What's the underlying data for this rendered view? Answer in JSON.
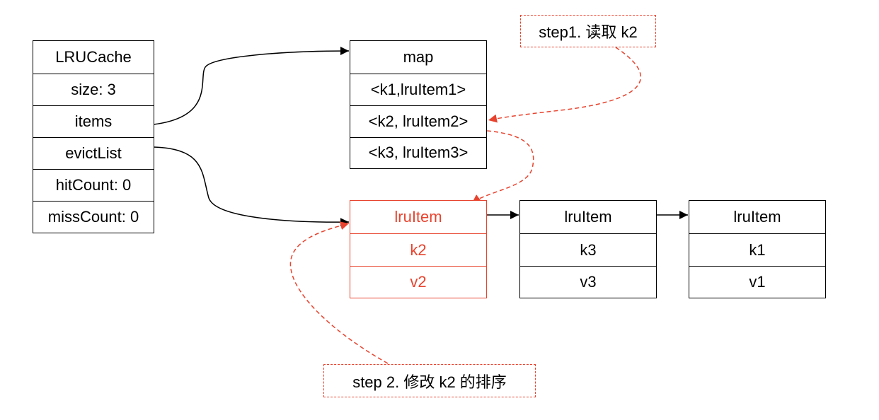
{
  "colors": {
    "line": "#000000",
    "highlight": "#e8432e"
  },
  "lru_cache": {
    "title": "LRUCache",
    "size": "size: 3",
    "items": "items",
    "evict_list": "evictList",
    "hit_count": "hitCount: 0",
    "miss_count": "missCount: 0"
  },
  "map": {
    "title": "map",
    "entries": [
      "<k1,lruItem1>",
      "<k2, lruItem2>",
      "<k3, lruItem3>"
    ]
  },
  "evict_list": [
    {
      "title": "lruItem",
      "key": "k2",
      "value": "v2",
      "highlighted": true
    },
    {
      "title": "lruItem",
      "key": "k3",
      "value": "v3",
      "highlighted": false
    },
    {
      "title": "lruItem",
      "key": "k1",
      "value": "v1",
      "highlighted": false
    }
  ],
  "notes": {
    "step1": "step1. 读取 k2",
    "step2": "step 2. 修改 k2 的排序"
  }
}
